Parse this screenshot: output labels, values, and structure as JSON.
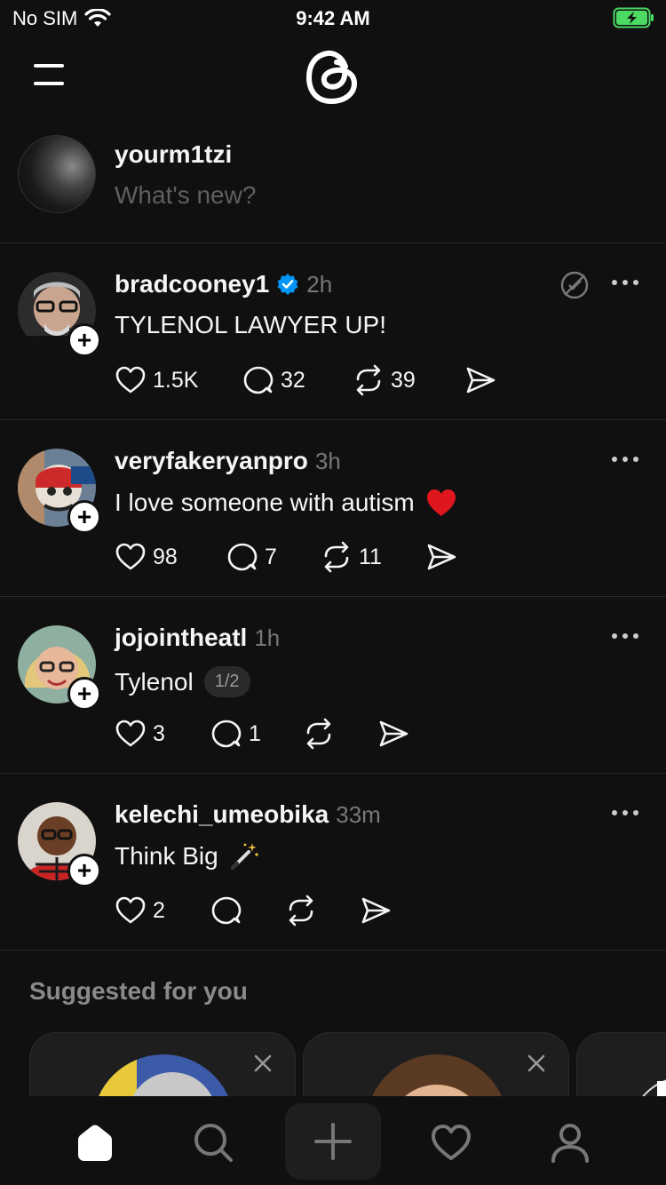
{
  "status_bar": {
    "carrier": "No SIM",
    "time": "9:42 AM"
  },
  "compose": {
    "username": "yourm1tzi",
    "placeholder": "What's new?"
  },
  "posts": [
    {
      "username": "bradcooney1",
      "verified": true,
      "time": "2h",
      "text": "TYLENOL LAWYER UP!",
      "likes": "1.5K",
      "replies": "32",
      "reposts": "39"
    },
    {
      "username": "veryfakeryanpro",
      "time": "3h",
      "text": "I love someone with autism",
      "emoji": "heart",
      "likes": "98",
      "replies": "7",
      "reposts": "11"
    },
    {
      "username": "jojointheatl",
      "time": "1h",
      "text": "Tylenol",
      "page_indicator": "1/2",
      "likes": "3",
      "replies": "1",
      "reposts": ""
    },
    {
      "username": "kelechi_umeobika",
      "time": "33m",
      "text": "Think Big",
      "emoji": "magic-wand",
      "likes": "2",
      "replies": "",
      "reposts": ""
    }
  ],
  "suggested": {
    "title": "Suggested for you"
  },
  "colors": {
    "background": "#101010",
    "text": "#f3f5f7",
    "muted": "#777777",
    "verified": "#0095f6",
    "battery": "#4cd964"
  },
  "icons": [
    "wifi-icon",
    "battery-charging-icon",
    "menu-icon",
    "threads-logo",
    "verified-icon",
    "mute-icon",
    "more-icon",
    "heart-icon",
    "reply-icon",
    "repost-icon",
    "share-icon",
    "home-icon",
    "search-icon",
    "create-icon",
    "activity-icon",
    "profile-icon",
    "close-icon"
  ]
}
